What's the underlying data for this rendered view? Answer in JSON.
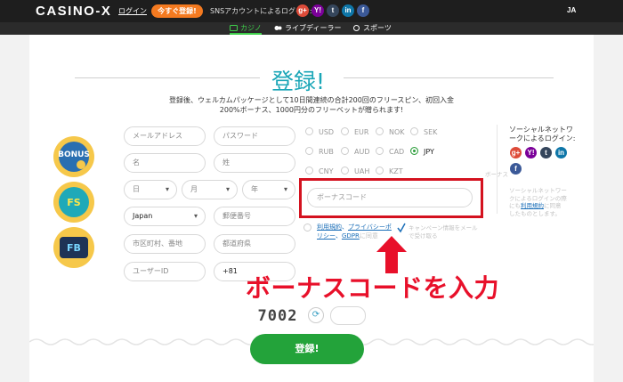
{
  "header": {
    "logo": "CASINO-X",
    "login_label": "ログイン",
    "signup_label": "今すぐ登録!",
    "sns_text": "SNSアカウントによるログイン:",
    "sns_icons": [
      {
        "name": "google-plus-icon",
        "glyph": "g+",
        "color": "#dd4b39"
      },
      {
        "name": "yahoo-icon",
        "glyph": "Y!",
        "color": "#7b0099"
      },
      {
        "name": "tumblr-icon",
        "glyph": "t",
        "color": "#35465c"
      },
      {
        "name": "linkedin-icon",
        "glyph": "in",
        "color": "#0e76a8"
      },
      {
        "name": "facebook-icon",
        "glyph": "f",
        "color": "#3b5998"
      }
    ],
    "lang": "JA"
  },
  "nav": {
    "tabs": [
      {
        "label": "カジノ",
        "active": true
      },
      {
        "label": "ライブディーラー",
        "active": false
      },
      {
        "label": "スポーツ",
        "active": false
      }
    ]
  },
  "main": {
    "title": "登録!",
    "subtitle_line1": "登録後、ウェルカムパッケージとして10日間連続の合計200回のフリースピン、初回入金",
    "subtitle_line2": "200%ボーナス、1000円分のフリーベットが贈られます!"
  },
  "badges": [
    {
      "name": "bonus-badge-icon",
      "label": "BONUS"
    },
    {
      "name": "free-spins-badge-icon",
      "label": "FS"
    },
    {
      "name": "free-bet-badge-icon",
      "label": "FB"
    }
  ],
  "form": {
    "email_placeholder": "メールアドレス",
    "password_placeholder": "パスワード",
    "first_name_placeholder": "名",
    "last_name_placeholder": "姓",
    "day_placeholder": "日",
    "month_placeholder": "月",
    "year_placeholder": "年",
    "country_value": "Japan",
    "postal_placeholder": "郵便番号",
    "city_placeholder": "市区町村、番地",
    "prefecture_placeholder": "都道府県",
    "user_id_placeholder": "ユーザーID",
    "phone_prefix": "+81"
  },
  "currencies": [
    {
      "code": "USD",
      "selected": false
    },
    {
      "code": "EUR",
      "selected": false
    },
    {
      "code": "NOK",
      "selected": false
    },
    {
      "code": "SEK",
      "selected": false
    },
    {
      "code": "RUB",
      "selected": false
    },
    {
      "code": "AUD",
      "selected": false
    },
    {
      "code": "CAD",
      "selected": false
    },
    {
      "code": "JPY",
      "selected": true
    },
    {
      "code": "CNY",
      "selected": false
    },
    {
      "code": "UAH",
      "selected": false
    },
    {
      "code": "KZT",
      "selected": false
    }
  ],
  "bonus": {
    "placeholder": "ボーナスコード",
    "faint_right": "ボーナス"
  },
  "terms": {
    "part1": "利用規約",
    "part2": "プライバシーポ",
    "part3": "リシー",
    "part4": "GDPR",
    "part5": "に同意",
    "promo_line1": "キャンペーン情報をメール",
    "promo_line2": "で受け取る"
  },
  "social": {
    "title_line1": "ソーシャルネットワ",
    "title_line2": "ークによるログイン:",
    "icons": [
      {
        "name": "google-plus-icon",
        "glyph": "g+",
        "color": "#dd4b39"
      },
      {
        "name": "yahoo-icon",
        "glyph": "Y!",
        "color": "#7b0099"
      },
      {
        "name": "tumblr-icon",
        "glyph": "t",
        "color": "#35465c"
      },
      {
        "name": "linkedin-icon",
        "glyph": "in",
        "color": "#0e76a8"
      },
      {
        "name": "facebook-icon",
        "glyph": "f",
        "color": "#3b5998"
      }
    ],
    "note_line1": "ソーシャルネットワー",
    "note_line2": "クによるログインの際",
    "note_line3": "にも",
    "note_link": "利用規約",
    "note_line3_end": "に同意",
    "note_line4": "したものとします。"
  },
  "annotation": "ボーナスコードを入力",
  "captcha": {
    "code": "7002"
  },
  "submit_label": "登録!"
}
